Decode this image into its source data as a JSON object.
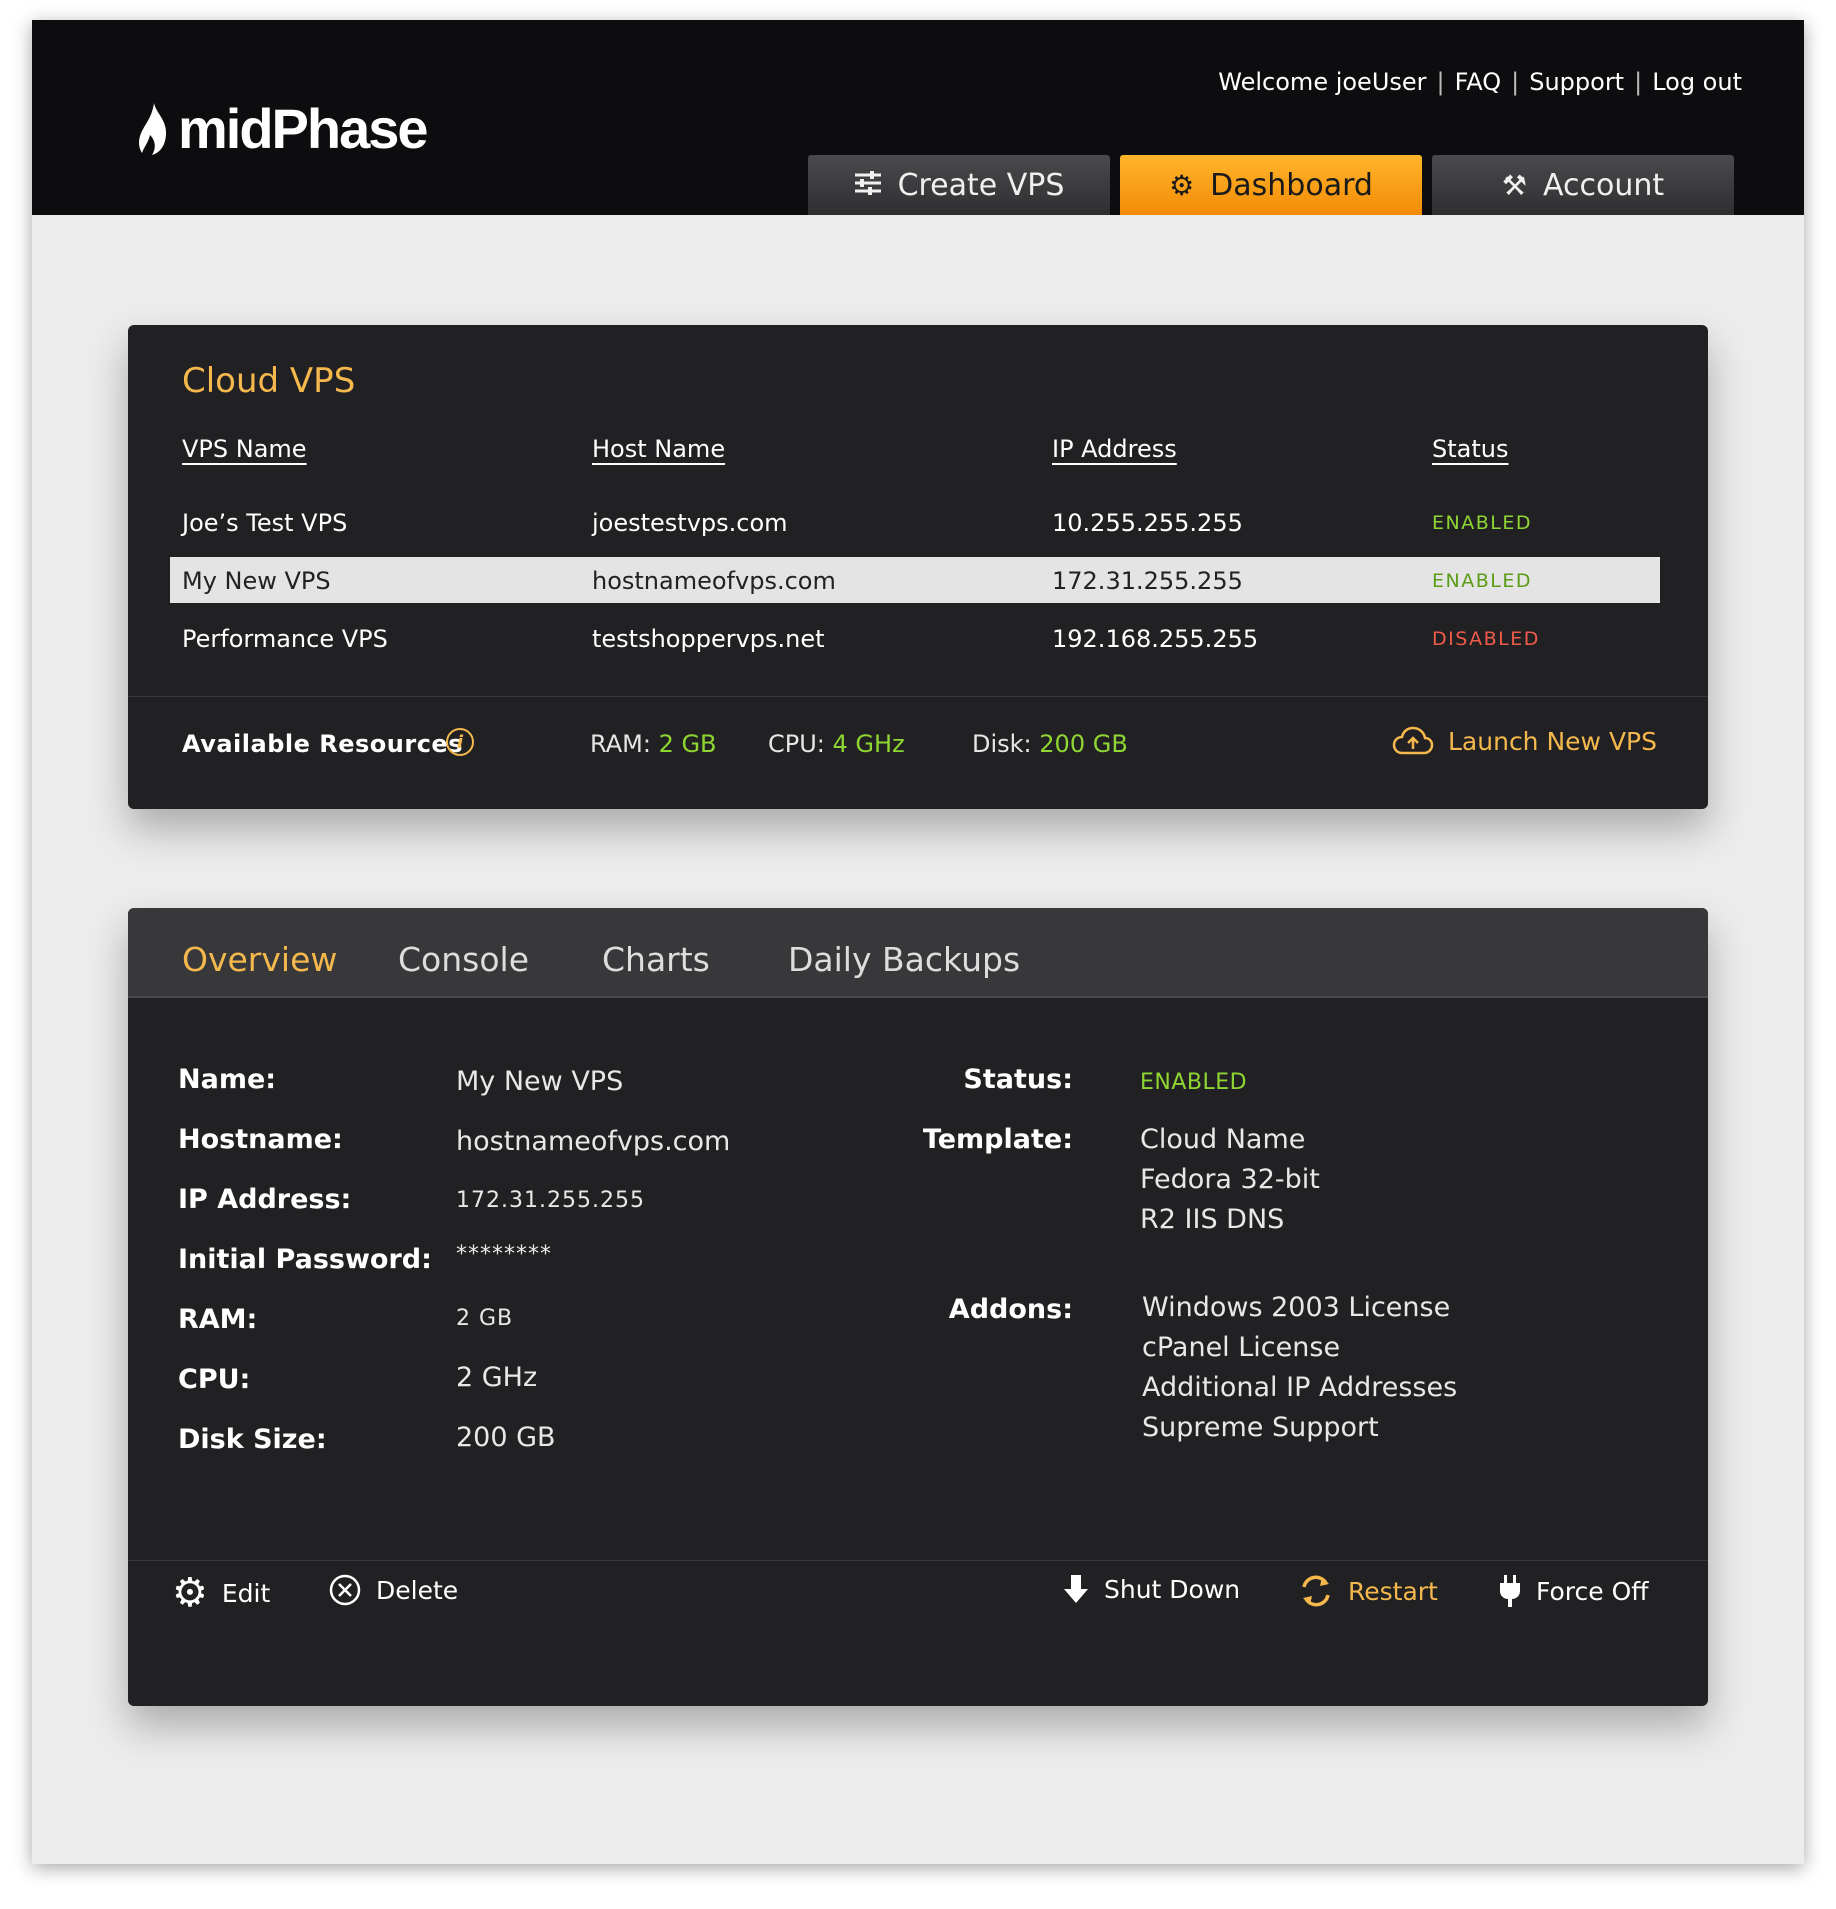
{
  "header": {
    "logo_text": "midPhase",
    "welcome": "Welcome joeUser",
    "links": [
      "FAQ",
      "Support",
      "Log out"
    ],
    "nav_tabs": [
      {
        "label": "Create VPS",
        "icon": "sliders-icon",
        "active": false
      },
      {
        "label": "Dashboard",
        "icon": "gear-icon",
        "active": true
      },
      {
        "label": "Account",
        "icon": "tools-icon",
        "active": false
      }
    ]
  },
  "vps_panel": {
    "title": "Cloud VPS",
    "columns": [
      "VPS Name",
      "Host Name",
      "IP Address",
      "Status"
    ],
    "rows": [
      {
        "name": "Joe’s Test VPS",
        "host": "joestestvps.com",
        "ip": "10.255.255.255",
        "status": "ENABLED",
        "selected": false
      },
      {
        "name": "My New VPS",
        "host": "hostnameofvps.com",
        "ip": "172.31.255.255",
        "status": "ENABLED",
        "selected": true
      },
      {
        "name": "Performance VPS",
        "host": "testshoppervps.net",
        "ip": "192.168.255.255",
        "status": "DISABLED",
        "selected": false
      }
    ],
    "resources": {
      "label": "Available Resources",
      "ram_label": "RAM:",
      "ram_value": "2 GB",
      "cpu_label": "CPU:",
      "cpu_value": "4 GHz",
      "disk_label": "Disk:",
      "disk_value": "200 GB",
      "launch_label": "Launch New VPS"
    },
    "colors": {
      "accent": "#f5b84d",
      "enabled": "#8fd633",
      "disabled": "#f05a4a"
    }
  },
  "detail_panel": {
    "tabs": [
      "Overview",
      "Console",
      "Charts",
      "Daily Backups"
    ],
    "active_tab": "Overview",
    "left": {
      "name_label": "Name:",
      "name_value": "My New VPS",
      "hostname_label": "Hostname:",
      "hostname_value": "hostnameofvps.com",
      "ip_label": "IP Address:",
      "ip_value": "172.31.255.255",
      "password_label": "Initial Password:",
      "password_value": "********",
      "ram_label": "RAM:",
      "ram_value": "2 GB",
      "cpu_label": "CPU:",
      "cpu_value": "2 GHz",
      "disk_label": "Disk Size:",
      "disk_value": "200 GB"
    },
    "right": {
      "status_label": "Status:",
      "status_value": "ENABLED",
      "template_label": "Template:",
      "template_lines": [
        "Cloud Name",
        "Fedora 32-bit",
        "R2 IIS DNS"
      ],
      "addons_label": "Addons:",
      "addons_lines": [
        "Windows 2003 License",
        "cPanel License",
        "Additional IP Addresses",
        "Supreme Support"
      ]
    },
    "actions": {
      "edit": "Edit",
      "delete": "Delete",
      "shutdown": "Shut Down",
      "restart": "Restart",
      "force_off": "Force Off"
    }
  }
}
